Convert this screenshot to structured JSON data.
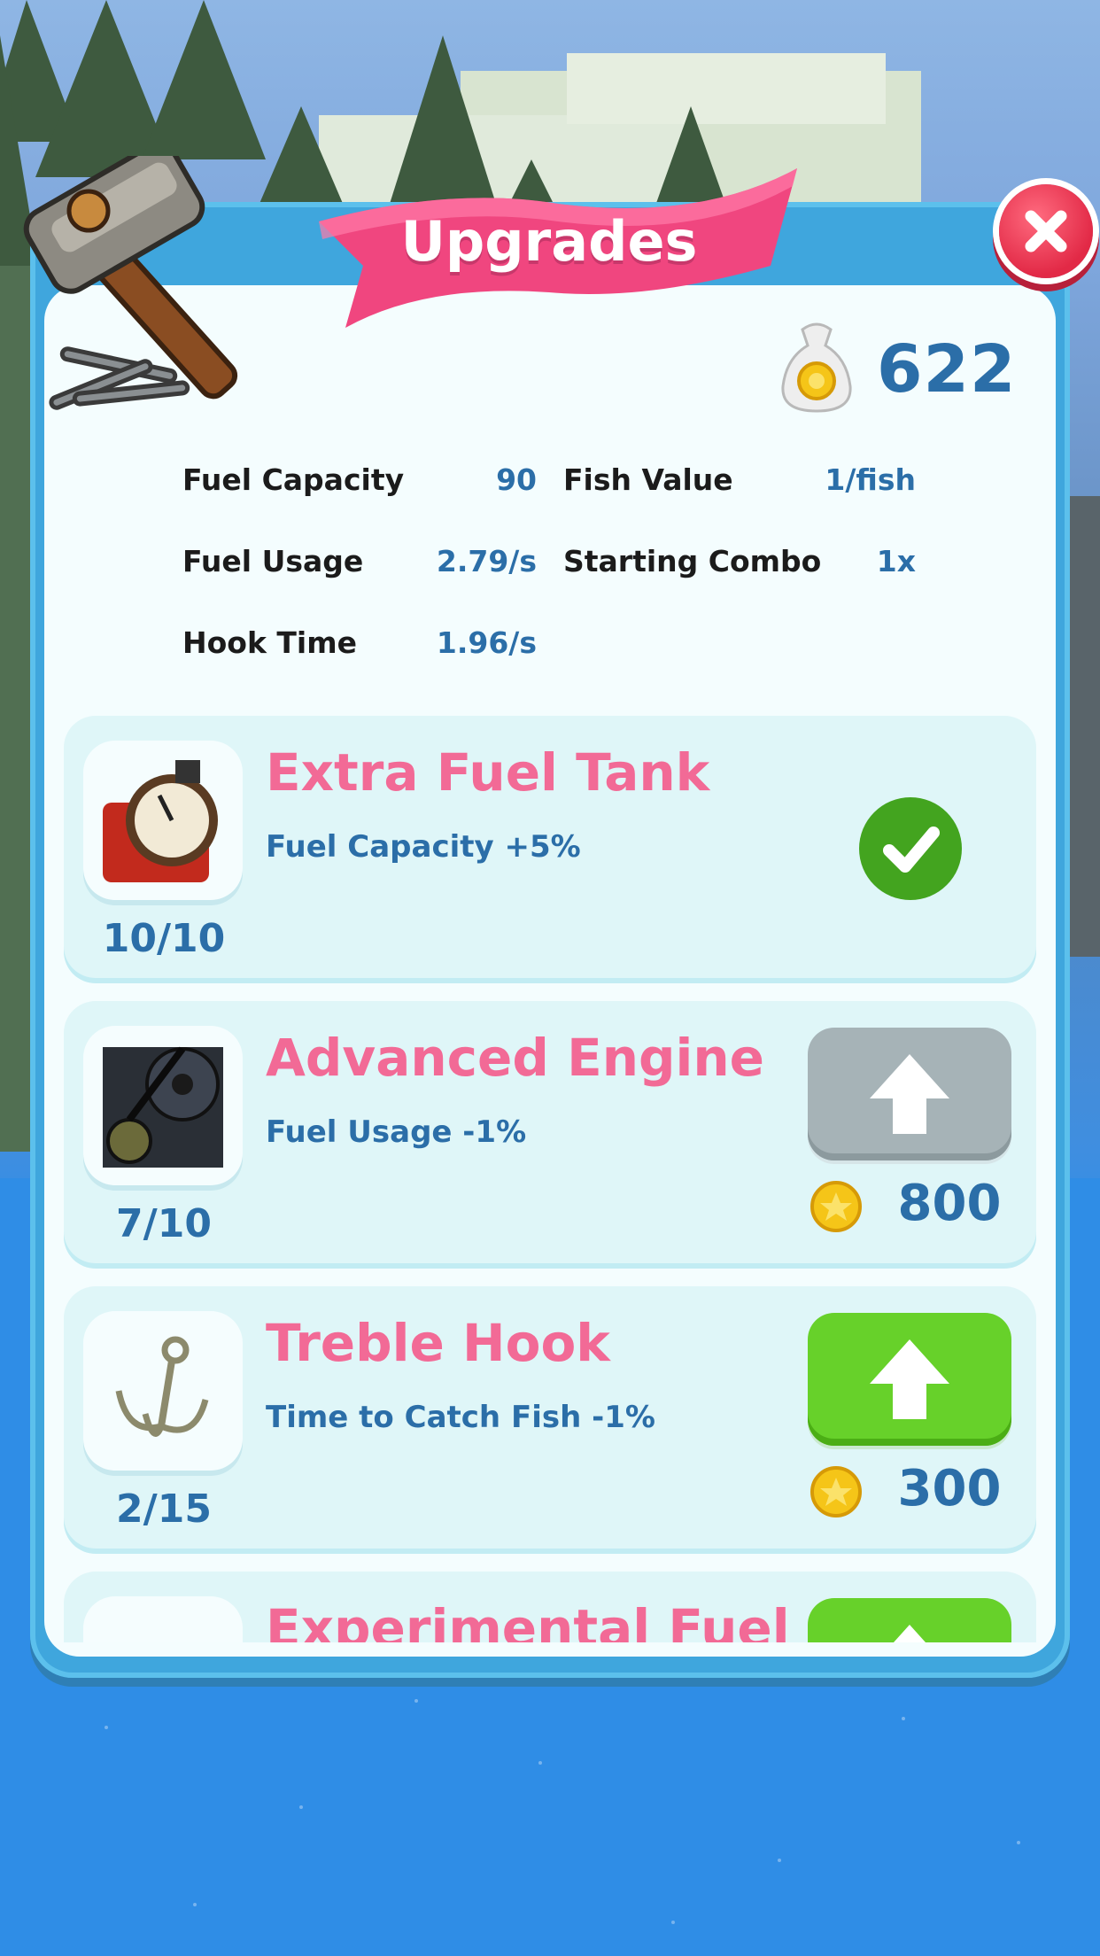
{
  "title": "Upgrades",
  "close_icon": "close-icon",
  "currency": {
    "icon": "coin-bag-icon",
    "amount": "622"
  },
  "stats": [
    {
      "label": "Fuel Capacity",
      "value": "90"
    },
    {
      "label": "Fish Value",
      "value": "1/fish"
    },
    {
      "label": "Fuel Usage",
      "value": "2.79/s"
    },
    {
      "label": "Starting Combo",
      "value": "1x"
    },
    {
      "label": "Hook Time",
      "value": "1.96/s"
    }
  ],
  "upgrades": [
    {
      "name": "Extra Fuel Tank",
      "effect": "Fuel Capacity +5%",
      "level": "10/10",
      "status": "maxed",
      "icon": "fuel-tank-icon"
    },
    {
      "name": "Advanced Engine",
      "effect": "Fuel Usage -1%",
      "level": "7/10",
      "status": "unaffordable",
      "price": "800",
      "icon": "engine-icon"
    },
    {
      "name": "Treble Hook",
      "effect": "Time to Catch Fish -1%",
      "level": "2/15",
      "status": "available",
      "price": "300",
      "icon": "treble-hook-icon"
    },
    {
      "name": "Experimental Fuel",
      "status": "available",
      "icon": "fuel-icon"
    }
  ],
  "colors": {
    "panel": "#3fa6dd",
    "title_ribbon": "#f0467f",
    "upgrade_name": "#f26a96",
    "value_text": "#2b6ea8",
    "button_enabled": "#67d12a",
    "button_disabled": "#a6b3b7",
    "checkmark": "#43a41f"
  }
}
